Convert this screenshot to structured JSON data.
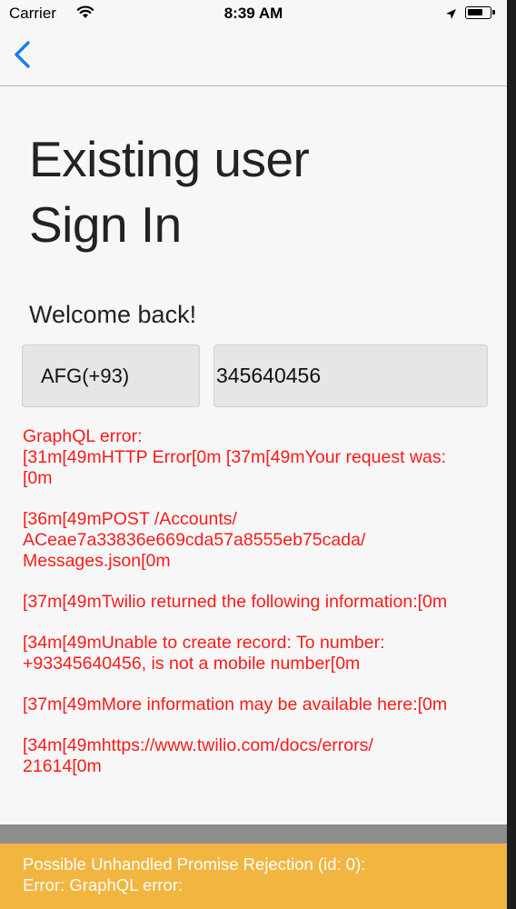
{
  "status_bar": {
    "carrier": "Carrier",
    "time": "8:39 AM"
  },
  "nav": {
    "back_icon": "chevron-left-icon",
    "accent": "#1a7cf5"
  },
  "signin": {
    "title_line1": "Existing user",
    "title_line2": "Sign In",
    "welcome": "Welcome back!",
    "country_code": "AFG(+93)",
    "phone_value": "345640456"
  },
  "error_lines": [
    "GraphQL error:\n[31m[49mHTTP Error[0m [37m[49mYour request was:\n[0m",
    "[36m[49mPOST /Accounts/\nACeae7a33836e669cda57a8555eb75cada/\nMessages.json[0m",
    "[37m[49mTwilio returned the following information:[0m",
    "[34m[49mUnable to create record: To number:\n+93345640456, is not a mobile number[0m",
    "[37m[49mMore information may be available here:[0m",
    "[34m[49mhttps://www.twilio.com/docs/errors/\n21614[0m"
  ],
  "toast": {
    "line1": "Possible Unhandled Promise Rejection (id: 0):",
    "line2": "Error: GraphQL error:",
    "color": "#f2b540"
  },
  "colors": {
    "error_text": "#ff1a1a"
  }
}
